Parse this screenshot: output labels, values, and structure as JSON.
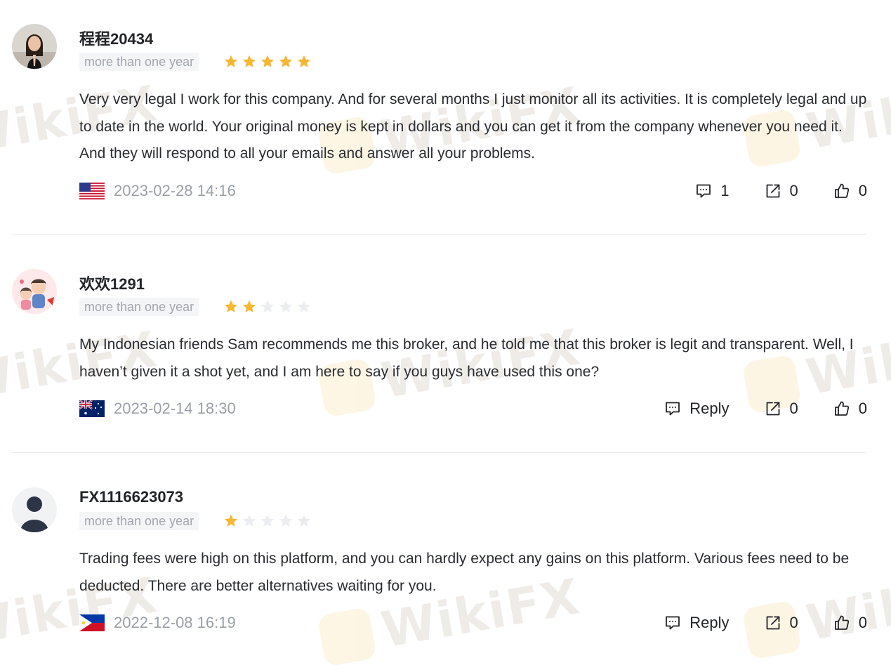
{
  "reviews": [
    {
      "username": "程程20434",
      "duration_tag": "more than one year",
      "rating": 5,
      "max_rating": 5,
      "text": "Very very legal I work for this company. And for several months I just monitor all its activities. It is completely legal and up to date in the world. Your original money is kept in dollars and you can get it from the company whenever you need it. And they will respond to all your emails and answer all your problems.",
      "country": "United States",
      "datetime": "2023-02-28 14:16",
      "reply_label": "1",
      "share_count": "0",
      "like_count": "0"
    },
    {
      "username": "欢欢1291",
      "duration_tag": "more than one year",
      "rating": 2,
      "max_rating": 5,
      "text": "My Indonesian friends Sam recommends me this broker, and he told me that this broker is legit and transparent. Well, I haven’t given it a shot yet, and I am here to say if you guys have used this one?",
      "country": "Australia",
      "datetime": "2023-02-14 18:30",
      "reply_label": "Reply",
      "share_count": "0",
      "like_count": "0"
    },
    {
      "username": "FX1116623073",
      "duration_tag": "more than one year",
      "rating": 1,
      "max_rating": 5,
      "text": "Trading fees were high on this platform, and you can hardly expect any gains on this platform. Various fees need to be deducted. There are better alternatives waiting for you.",
      "country": "Philippines",
      "datetime": "2022-12-08 16:19",
      "reply_label": "Reply",
      "share_count": "0",
      "like_count": "0"
    }
  ],
  "watermark": {
    "text": "WikiFX",
    "logo_color": "#f2a900"
  },
  "colors": {
    "star_filled": "#f7b731",
    "star_empty": "#ebedf0",
    "text": "#222428",
    "muted": "#9ba0a8"
  },
  "icons": {
    "reply": "comment-dots-icon",
    "share": "share-external-icon",
    "like": "thumbs-up-icon"
  }
}
